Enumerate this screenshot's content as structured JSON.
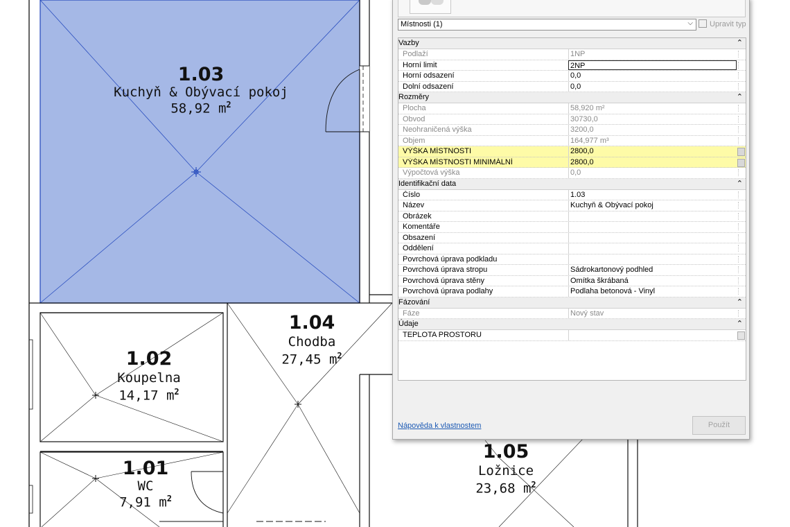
{
  "floor_plan": {
    "rooms": [
      {
        "id": "1.03",
        "name": "Kuchyň & Obývací pokoj",
        "area": "58,92 m",
        "area_unit_sup": "2",
        "selected": true
      },
      {
        "id": "1.04",
        "name": "Chodba",
        "area": "27,45 m",
        "area_unit_sup": "2",
        "selected": false
      },
      {
        "id": "1.02",
        "name": "Koupelna",
        "area": "14,17 m",
        "area_unit_sup": "2",
        "selected": false
      },
      {
        "id": "1.01",
        "name": "WC",
        "area": "7,91 m",
        "area_unit_sup": "2",
        "selected": false
      },
      {
        "id": "1.05",
        "name": "Ložnice",
        "area": "23,68 m",
        "area_unit_sup": "2",
        "selected": false
      }
    ],
    "selected_fill": "#a5b8e6",
    "selected_stroke": "#2b4fbf"
  },
  "properties_panel": {
    "selector_label": "Místnosti (1)",
    "edit_type_label": "Upravit typ",
    "groups": [
      {
        "label": "Vazby",
        "rows": [
          {
            "name": "Podlaží",
            "value": "1NP",
            "state": "readonly"
          },
          {
            "name": "Horní limit",
            "value": "2NP",
            "state": "editing"
          },
          {
            "name": "Horní odsazení",
            "value": "0,0",
            "state": "normal"
          },
          {
            "name": "Dolní odsazení",
            "value": "0,0",
            "state": "normal"
          }
        ]
      },
      {
        "label": "Rozměry",
        "rows": [
          {
            "name": "Plocha",
            "value": "58,920 m²",
            "state": "readonly"
          },
          {
            "name": "Obvod",
            "value": "30730,0",
            "state": "readonly"
          },
          {
            "name": "Neohraničená výška",
            "value": "3200,0",
            "state": "readonly"
          },
          {
            "name": "Objem",
            "value": "164,977 m³",
            "state": "readonly"
          },
          {
            "name": "VÝŠKA MÍSTNOSTI",
            "value": "2800,0",
            "state": "highlighted"
          },
          {
            "name": "VÝŠKA MÍSTNOSTI MINIMÁLNÍ",
            "value": "2800,0",
            "state": "highlighted"
          },
          {
            "name": "Výpočtová výška",
            "value": "0,0",
            "state": "readonly"
          }
        ]
      },
      {
        "label": "Identifikační data",
        "rows": [
          {
            "name": "Číslo",
            "value": "1.03",
            "state": "normal"
          },
          {
            "name": "Název",
            "value": "Kuchyň & Obývací pokoj",
            "state": "normal"
          },
          {
            "name": "Obrázek",
            "value": "",
            "state": "normal"
          },
          {
            "name": "Komentáře",
            "value": "",
            "state": "normal"
          },
          {
            "name": "Obsazení",
            "value": "",
            "state": "normal"
          },
          {
            "name": "Oddělení",
            "value": "",
            "state": "normal"
          },
          {
            "name": "Povrchová úprava podkladu",
            "value": "",
            "state": "normal"
          },
          {
            "name": "Povrchová úprava stropu",
            "value": "Sádrokartonový podhled",
            "state": "normal"
          },
          {
            "name": "Povrchová úprava stěny",
            "value": "Omítka škrábaná",
            "state": "normal"
          },
          {
            "name": "Povrchová úprava podlahy",
            "value": "Podlaha betonová - Vinyl",
            "state": "normal"
          }
        ]
      },
      {
        "label": "Fázování",
        "rows": [
          {
            "name": "Fáze",
            "value": "Nový stav",
            "state": "readonly"
          }
        ]
      },
      {
        "label": "Údaje",
        "rows": [
          {
            "name": "TEPLOTA PROSTORU",
            "value": "",
            "state": "button"
          }
        ]
      }
    ],
    "collapse_glyph": "⌃",
    "help_link": "Nápověda k vlastnostem",
    "apply_label": "Použít",
    "highlight_color": "#fefba7"
  }
}
